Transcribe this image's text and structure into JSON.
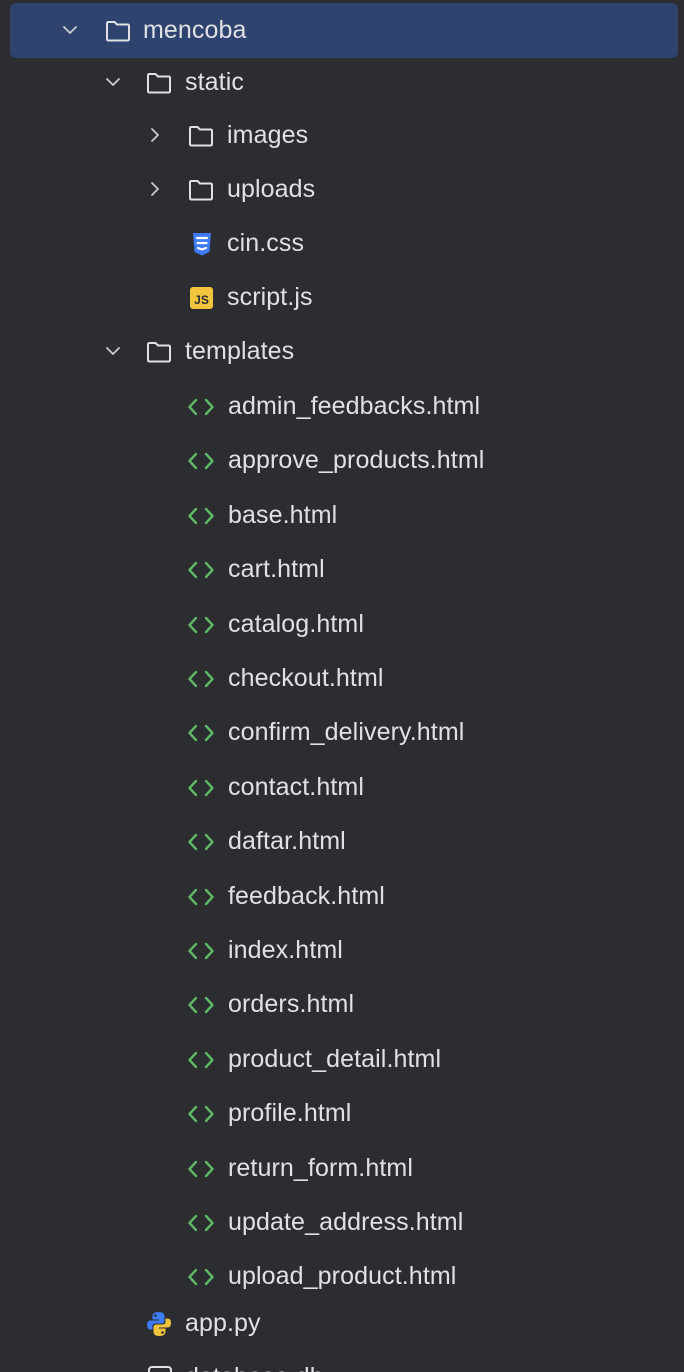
{
  "colors": {
    "background": "#2b2d30",
    "selection": "#2e436e",
    "text": "#dfe1e5",
    "html_icon": "#5fb865",
    "css_icon": "#3d7cf5",
    "js_icon": "#f0c43d"
  },
  "tree": {
    "root": {
      "label": "mencoba",
      "icon": "folder-icon",
      "expanded": true,
      "selected": true
    },
    "static": {
      "label": "static",
      "icon": "folder-icon",
      "expanded": true
    },
    "images": {
      "label": "images",
      "icon": "folder-icon",
      "expanded": false
    },
    "uploads": {
      "label": "uploads",
      "icon": "folder-icon",
      "expanded": false
    },
    "cin_css": {
      "label": "cin.css",
      "icon": "css-file-icon"
    },
    "script_js": {
      "label": "script.js",
      "icon": "js-file-icon",
      "icon_text": "JS"
    },
    "templates": {
      "label": "templates",
      "icon": "folder-icon",
      "expanded": true
    },
    "template_files": [
      "admin_feedbacks.html",
      "approve_products.html",
      "base.html",
      "cart.html",
      "catalog.html",
      "checkout.html",
      "confirm_delivery.html",
      "contact.html",
      "daftar.html",
      "feedback.html",
      "index.html",
      "orders.html",
      "product_detail.html",
      "profile.html",
      "return_form.html",
      "update_address.html",
      "upload_product.html"
    ],
    "app_py": {
      "label": "app.py",
      "icon": "python-file-icon"
    },
    "database_db": {
      "label": "database.db",
      "icon": "unknown-file-icon",
      "icon_text": "?"
    }
  }
}
